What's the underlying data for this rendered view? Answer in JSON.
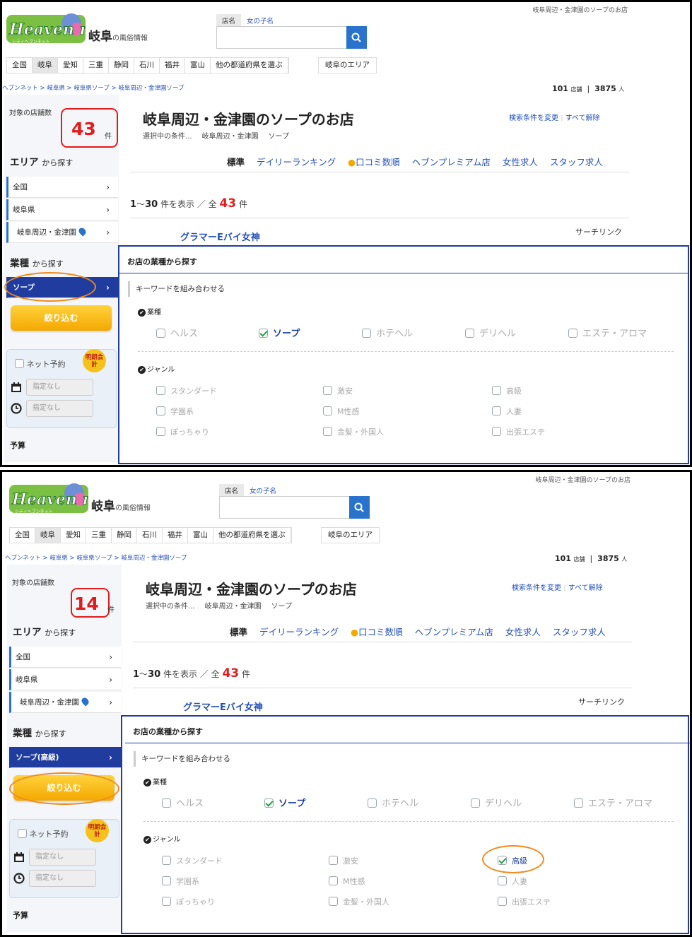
{
  "header": {
    "logo_text": "Heaven net",
    "logo_ruby": "シティヘブンネット",
    "region_name": "岐阜",
    "region_suffix": "の風俗情報",
    "top_link": "岐阜周辺・金津園のソープのお店",
    "search_tabs": [
      "店名",
      "女の子名"
    ]
  },
  "prefecture_tabs": [
    "全国",
    "岐阜",
    "愛知",
    "三重",
    "静岡",
    "石川",
    "福井",
    "富山",
    "他の都道府県を選ぶ"
  ],
  "area_button": "岐阜のエリア",
  "breadcrumb": "ヘブンネット > 岐阜県 > 岐阜県ソープ > 岐阜周辺・金津園ソープ",
  "stats": {
    "shops": "101",
    "shops_unit": "店舗",
    "people": "3875",
    "people_unit": "人"
  },
  "sidebar": {
    "count_label": "対象の店舗数",
    "count_unit": "件",
    "area_head": "エリア",
    "head_suffix": "から探す",
    "area_items": [
      "全国",
      "岐阜県",
      "岐阜周辺・金津園"
    ],
    "genre_head": "業種",
    "narrow_button": "絞り込む",
    "net_reserve": "ネット予約",
    "badge_text": "明朗会計",
    "unspecified": "指定なし",
    "budget": "予算"
  },
  "main": {
    "title": "岐阜周辺・金津園のソープのお店",
    "cond_label": "選択中の条件...",
    "cond_values": [
      "岐阜周辺・金津園",
      "ソープ"
    ],
    "links": [
      "検索条件を変更",
      "すべて解除"
    ],
    "tabs": [
      "標準",
      "デイリーランキング",
      "口コミ数順",
      "ヘブンプレミアム店",
      "女性求人",
      "スタッフ求人"
    ],
    "range_start": "1",
    "range_end": "30",
    "range_text1": "件を表示 ／ 全",
    "total": "43",
    "range_text2": "件",
    "shop_name": "グラマーEバイ女神",
    "search_link": "サーチリンク"
  },
  "overlay": {
    "title": "お店の業種から探す",
    "keyword_head": "キーワードを組み合わせる",
    "type_group": "業種",
    "types": [
      "ヘルス",
      "ソープ",
      "ホテヘル",
      "デリヘル",
      "エステ・アロマ"
    ],
    "genre_group": "ジャンル",
    "genres": [
      "スタンダード",
      "激安",
      "高級",
      "学園系",
      "M性感",
      "人妻",
      "ぽっちゃり",
      "金髪・外国人",
      "出張エステ"
    ]
  },
  "shots": [
    {
      "count": "43",
      "selected_genre": "ソープ",
      "checked_genres": []
    },
    {
      "count": "14",
      "selected_genre": "ソープ(高級)",
      "checked_genres": [
        "高級"
      ]
    }
  ],
  "colors": {
    "accent_red": "#e21c1c",
    "nav_blue": "#1f3c9e",
    "link_blue": "#2450b8",
    "highlight_orange": "#f08a1c",
    "button_yellow": "#f4b400"
  }
}
